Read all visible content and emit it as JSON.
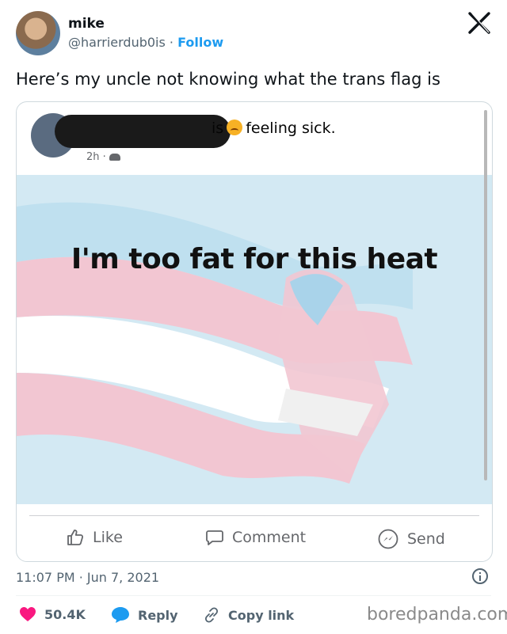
{
  "header": {
    "display_name": "mike",
    "handle": "@harrierdub0is",
    "separator": "·",
    "follow_label": "Follow",
    "logo_icon": "x-logo-icon"
  },
  "tweet": {
    "text": "Here’s my uncle not knowing what the trans flag is"
  },
  "embedded_post": {
    "status_prefix": "is",
    "status_text": "feeling sick.",
    "time_ago": "2h ·",
    "image_text": "I'm too fat for this heat",
    "actions": {
      "like": "Like",
      "comment": "Comment",
      "send": "Send"
    },
    "flag_colors": {
      "blue": "#b7ddef",
      "pink": "#f2c6d2",
      "white": "#ffffff"
    }
  },
  "footer": {
    "timestamp": "11:07 PM · Jun 7, 2021",
    "likes": "50.4K",
    "reply_label": "Reply",
    "copy_link_label": "Copy link",
    "watermark": "boredpanda.com"
  },
  "colors": {
    "accent": "#1d9bf0",
    "like": "#f91880",
    "muted": "#536471"
  }
}
